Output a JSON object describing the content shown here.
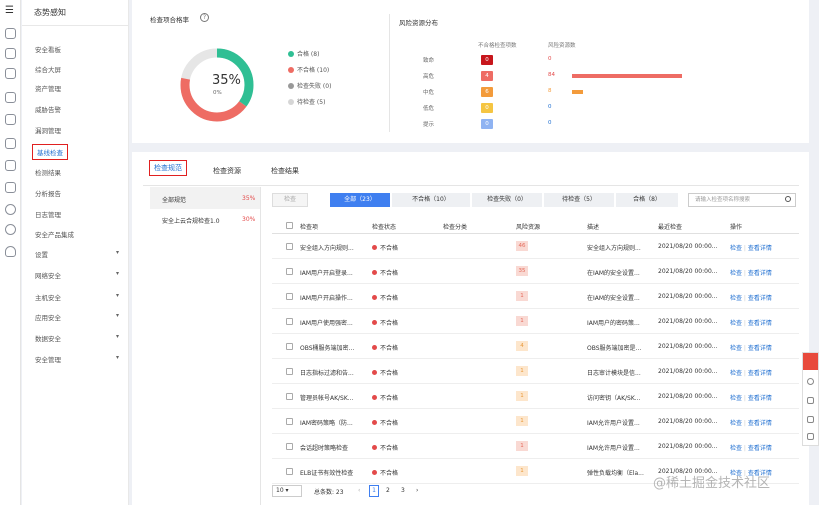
{
  "sidebar": {
    "title": "态势感知",
    "items": [
      {
        "label": "安全看板",
        "active": false,
        "expandable": false
      },
      {
        "label": "综合大屏",
        "active": false,
        "expandable": false
      },
      {
        "label": "资产管理",
        "active": false,
        "expandable": false
      },
      {
        "label": "威胁告警",
        "active": false,
        "expandable": false
      },
      {
        "label": "漏洞管理",
        "active": false,
        "expandable": false
      },
      {
        "label": "基线检查",
        "active": true,
        "expandable": false
      },
      {
        "label": "检测结果",
        "active": false,
        "expandable": false
      },
      {
        "label": "分析报告",
        "active": false,
        "expandable": false
      },
      {
        "label": "日志管理",
        "active": false,
        "expandable": false
      },
      {
        "label": "安全产品集成",
        "active": false,
        "expandable": false
      },
      {
        "label": "设置",
        "active": false,
        "expandable": true
      },
      {
        "label": "网络安全",
        "active": false,
        "expandable": true
      },
      {
        "label": "主机安全",
        "active": false,
        "expandable": true
      },
      {
        "label": "应用安全",
        "active": false,
        "expandable": true
      },
      {
        "label": "数据安全",
        "active": false,
        "expandable": true
      },
      {
        "label": "安全管理",
        "active": false,
        "expandable": true
      }
    ]
  },
  "overview": {
    "pass_rate_title": "检查项合格率",
    "pass_rate": "35%",
    "pass_rate_sub": "0%",
    "pass_fraction": 0.35,
    "fail_fraction": 0.43,
    "legend": [
      {
        "label": "合格 (8)",
        "color": "#2fbf94"
      },
      {
        "label": "不合格 (10)",
        "color": "#ee6c64"
      },
      {
        "label": "检查失败 (0)",
        "color": "#999999"
      },
      {
        "label": "待检查 (5)",
        "color": "#d6d6d6"
      }
    ],
    "risk_title": "风险资源分布",
    "risk_col1": "不合格检查项数",
    "risk_col2": "风险资源数",
    "risk_rows": [
      {
        "level": "致命",
        "count": "0",
        "color": "#c7161c",
        "resources": "0",
        "res_color": "#e34a4a",
        "bar_fraction": 0
      },
      {
        "level": "高危",
        "count": "4",
        "color": "#ee6c64",
        "resources": "84",
        "res_color": "#e34a4a",
        "bar_fraction": 1.0
      },
      {
        "level": "中危",
        "count": "6",
        "color": "#f39b3b",
        "resources": "8",
        "res_color": "#f39b3b",
        "bar_fraction": 0.1
      },
      {
        "level": "低危",
        "count": "0",
        "color": "#f5c542",
        "resources": "0",
        "res_color": "#1f6fd1",
        "bar_fraction": 0
      },
      {
        "level": "提示",
        "count": "0",
        "color": "#8fb3f2",
        "resources": "0",
        "res_color": "#1f6fd1",
        "bar_fraction": 0
      }
    ]
  },
  "tabs": [
    "检查规范",
    "检查资源",
    "检查结果"
  ],
  "standards": [
    {
      "name": "全部规范",
      "pct": "35%"
    },
    {
      "name": "安全上云合规检查1.0",
      "pct": "30%"
    }
  ],
  "toolbar": {
    "check_button": "检查",
    "filters": [
      "全部（23）",
      "不合格（10）",
      "检查失败（0）",
      "待检查（5）",
      "合格（8）"
    ],
    "search_placeholder": "请输入检查项名称搜索"
  },
  "table": {
    "headers": [
      "检查项",
      "检查状态",
      "检查分类",
      "风险资源",
      "描述",
      "最近检查",
      "操作"
    ],
    "rows": [
      {
        "item": "安全组入方向规则...",
        "status": "不合格",
        "risk": "46",
        "risk_level": "high",
        "desc": "安全组入方向规则...",
        "time": "2021/08/20 00:00...",
        "op1": "检查",
        "op2": "查看详情"
      },
      {
        "item": "IAM用户开启登录...",
        "status": "不合格",
        "risk": "35",
        "risk_level": "high",
        "desc": "在IAM的安全设置...",
        "time": "2021/08/20 00:00...",
        "op1": "检查",
        "op2": "查看详情"
      },
      {
        "item": "IAM用户开启操作...",
        "status": "不合格",
        "risk": "1",
        "risk_level": "high",
        "desc": "在IAM的安全设置...",
        "time": "2021/08/20 00:00...",
        "op1": "检查",
        "op2": "查看详情"
      },
      {
        "item": "IAM用户使用强密...",
        "status": "不合格",
        "risk": "1",
        "risk_level": "high",
        "desc": "IAM用户的密码策...",
        "time": "2021/08/20 00:00...",
        "op1": "检查",
        "op2": "查看详情"
      },
      {
        "item": "OBS桶服务端加密...",
        "status": "不合格",
        "risk": "4",
        "risk_level": "medium",
        "desc": "OBS服务端加密是...",
        "time": "2021/08/20 00:00...",
        "op1": "检查",
        "op2": "查看详情"
      },
      {
        "item": "日志指标过滤和告...",
        "status": "不合格",
        "risk": "1",
        "risk_level": "medium",
        "desc": "日志审计模块是信...",
        "time": "2021/08/20 00:00...",
        "op1": "检查",
        "op2": "查看详情"
      },
      {
        "item": "管理员帐号AK/SK...",
        "status": "不合格",
        "risk": "1",
        "risk_level": "medium",
        "desc": "访问密钥（AK/SK...",
        "time": "2021/08/20 00:00...",
        "op1": "检查",
        "op2": "查看详情"
      },
      {
        "item": "IAM密码策略（防...",
        "status": "不合格",
        "risk": "1",
        "risk_level": "medium",
        "desc": "IAM允许用户设置...",
        "time": "2021/08/20 00:00...",
        "op1": "检查",
        "op2": "查看详情"
      },
      {
        "item": "会话超时策略检查",
        "status": "不合格",
        "risk": "1",
        "risk_level": "high",
        "desc": "IAM允许用户设置...",
        "time": "2021/08/20 00:00...",
        "op1": "检查",
        "op2": "查看详情"
      },
      {
        "item": "ELB证书有效性检查",
        "status": "不合格",
        "risk": "1",
        "risk_level": "medium",
        "desc": "弹性负载均衡（Ela...",
        "time": "2021/08/20 00:00...",
        "op1": "检查",
        "op2": "查看详情"
      }
    ]
  },
  "pagination": {
    "page_size": "10",
    "total": "总条数: 23",
    "pages": [
      "1",
      "2",
      "3"
    ],
    "current": "1",
    "prev": "‹",
    "next": "›"
  },
  "watermark": "@稀土掘金技术社区"
}
